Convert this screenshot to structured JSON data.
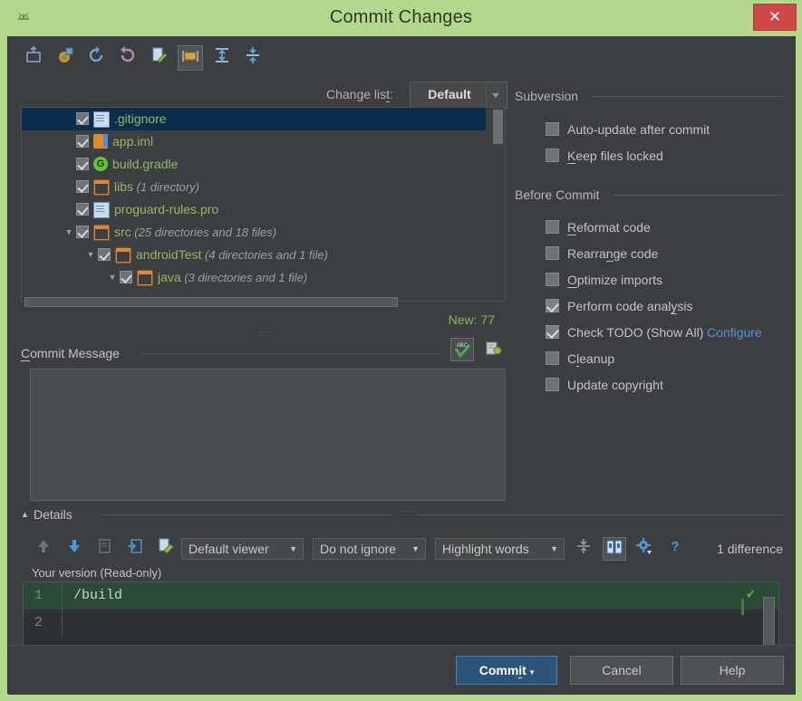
{
  "window": {
    "title": "Commit Changes",
    "app_icon": "android-studio-icon",
    "close_label": "✕",
    "accent_titlebar": "#b4d78e",
    "accent_primary": "#2d5579"
  },
  "toolbar": {
    "buttons": [
      {
        "name": "show-diff-icon",
        "glyph": "⬆"
      },
      {
        "name": "revert-with-comment-icon",
        "glyph": "◒"
      },
      {
        "name": "refresh-icon",
        "glyph": "⟳"
      },
      {
        "name": "revert-icon",
        "glyph": "↩"
      },
      {
        "name": "edit-source-icon",
        "glyph": "✎"
      },
      {
        "name": "group-by-directory-icon",
        "glyph": "▣",
        "active": true
      },
      {
        "name": "expand-all-icon",
        "glyph": "⇳"
      },
      {
        "name": "collapse-all-icon",
        "glyph": "⇹"
      }
    ],
    "changelist_label": "Change list:",
    "changelist_value": "Default"
  },
  "file_tree": {
    "rows": [
      {
        "indent": 0,
        "twisty": "",
        "checked": true,
        "icon": "file-icon",
        "name": ".gitignore",
        "meta": "",
        "selected": true
      },
      {
        "indent": 0,
        "twisty": "",
        "checked": true,
        "icon": "module-icon",
        "name": "app.iml",
        "meta": "",
        "selected": false
      },
      {
        "indent": 0,
        "twisty": "",
        "checked": true,
        "icon": "gradle-icon",
        "name": "build.gradle",
        "meta": "",
        "selected": false
      },
      {
        "indent": 0,
        "twisty": "",
        "checked": true,
        "icon": "folder-icon",
        "name": "libs",
        "meta": "(1 directory)",
        "selected": false
      },
      {
        "indent": 0,
        "twisty": "",
        "checked": true,
        "icon": "file-icon",
        "name": "proguard-rules.pro",
        "meta": "",
        "selected": false
      },
      {
        "indent": 0,
        "twisty": "▼",
        "checked": true,
        "icon": "folder-icon",
        "name": "src",
        "meta": "(25 directories and 18 files)",
        "selected": false
      },
      {
        "indent": 1,
        "twisty": "▼",
        "checked": true,
        "icon": "folder-icon",
        "name": "androidTest",
        "meta": "(4 directories and 1 file)",
        "selected": false
      },
      {
        "indent": 2,
        "twisty": "▼",
        "checked": true,
        "icon": "folder-icon",
        "name": "java",
        "meta": "(3 directories and 1 file)",
        "selected": false
      }
    ]
  },
  "subversion": {
    "title": "Subversion",
    "options": [
      {
        "label": "Auto-update after commit",
        "checked": false,
        "mnemonic": ""
      },
      {
        "label": "Keep files locked",
        "checked": false,
        "mnemonic": "K"
      }
    ]
  },
  "before_commit": {
    "title": "Before Commit",
    "options": [
      {
        "label": "Reformat code",
        "checked": false,
        "mnemonic": "R"
      },
      {
        "label": "Rearrange code",
        "checked": false,
        "mnemonic": "n"
      },
      {
        "label": "Optimize imports",
        "checked": false,
        "mnemonic": "O"
      },
      {
        "label": "Perform code analysis",
        "checked": true,
        "mnemonic": "y"
      },
      {
        "label": "Check TODO (Show All)",
        "checked": true,
        "mnemonic": "",
        "link": "Configure"
      },
      {
        "label": "Cleanup",
        "checked": false,
        "mnemonic": "l"
      },
      {
        "label": "Update copyright",
        "checked": false,
        "mnemonic": ""
      }
    ]
  },
  "commit_message": {
    "new_count_label": "New: 77",
    "label": "Commit Message",
    "value": "",
    "placeholder": "",
    "icons": [
      {
        "name": "spellcheck-icon",
        "glyph": "ABC",
        "active": true
      },
      {
        "name": "message-history-icon",
        "glyph": "▤"
      }
    ]
  },
  "details": {
    "title": "Details",
    "collapse_glyph": "▲",
    "toolbar_icons": [
      {
        "name": "previous-difference-icon",
        "glyph": "⬆"
      },
      {
        "name": "next-difference-icon",
        "glyph": "⬇"
      },
      {
        "name": "revert-change-icon",
        "glyph": "▤"
      },
      {
        "name": "apply-change-icon",
        "glyph": "▥"
      },
      {
        "name": "edit-source-icon",
        "glyph": "✎"
      }
    ],
    "viewer_combo": "Default viewer",
    "ignore_combo": "Do not ignore",
    "highlight_combo": "Highlight words",
    "right_icons": [
      {
        "name": "collapse-unchanged-icon",
        "glyph": "⇹",
        "active": false
      },
      {
        "name": "side-by-side-view-icon",
        "glyph": "▯▯",
        "active": true
      },
      {
        "name": "diff-settings-gear-icon",
        "glyph": "✾",
        "active": false
      },
      {
        "name": "help-icon",
        "glyph": "?",
        "active": false
      }
    ],
    "difference_count": "1 difference"
  },
  "diff": {
    "pane_title": "Your version (Read-only)",
    "lines": [
      {
        "number": "1",
        "text": "/build",
        "added": true
      },
      {
        "number": "2",
        "text": "",
        "added": false
      }
    ],
    "marker_glyph": "✔"
  },
  "footer": {
    "commit_label": "Commit",
    "commit_caret": "▾",
    "cancel_label": "Cancel",
    "help_label": "Help"
  }
}
